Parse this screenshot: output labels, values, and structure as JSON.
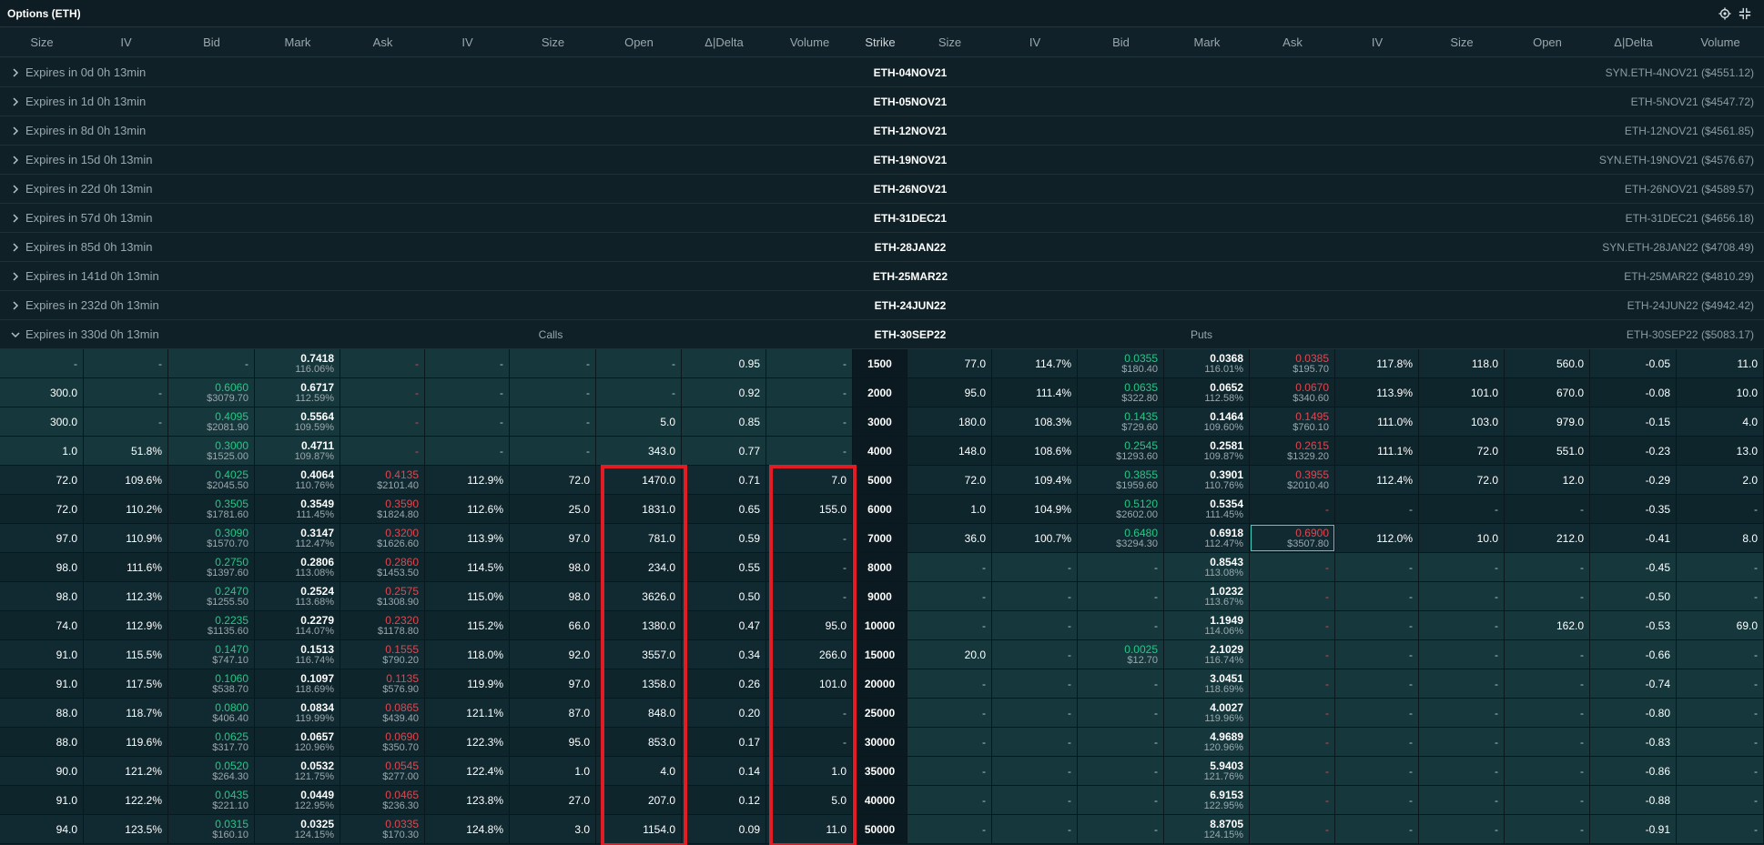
{
  "window": {
    "title": "Options (ETH)"
  },
  "header": {
    "call_cols": [
      "Size",
      "IV",
      "Bid",
      "Mark",
      "Ask",
      "IV",
      "Size",
      "Open",
      "Δ|Delta",
      "Volume"
    ],
    "strike": "Strike",
    "put_cols": [
      "Size",
      "IV",
      "Bid",
      "Mark",
      "Ask",
      "IV",
      "Size",
      "Open",
      "Δ|Delta",
      "Volume"
    ]
  },
  "expiries": [
    {
      "label": "Expires in 0d 0h 13min",
      "instrument": "ETH-04NOV21",
      "index": "SYN.ETH-4NOV21 ($4551.12)"
    },
    {
      "label": "Expires in 1d 0h 13min",
      "instrument": "ETH-05NOV21",
      "index": "ETH-5NOV21 ($4547.72)"
    },
    {
      "label": "Expires in 8d 0h 13min",
      "instrument": "ETH-12NOV21",
      "index": "ETH-12NOV21 ($4561.85)"
    },
    {
      "label": "Expires in 15d 0h 13min",
      "instrument": "ETH-19NOV21",
      "index": "SYN.ETH-19NOV21 ($4576.67)"
    },
    {
      "label": "Expires in 22d 0h 13min",
      "instrument": "ETH-26NOV21",
      "index": "ETH-26NOV21 ($4589.57)"
    },
    {
      "label": "Expires in 57d 0h 13min",
      "instrument": "ETH-31DEC21",
      "index": "ETH-31DEC21 ($4656.18)"
    },
    {
      "label": "Expires in 85d 0h 13min",
      "instrument": "ETH-28JAN22",
      "index": "SYN.ETH-28JAN22 ($4708.49)"
    },
    {
      "label": "Expires in 141d 0h 13min",
      "instrument": "ETH-25MAR22",
      "index": "ETH-25MAR22 ($4810.29)"
    },
    {
      "label": "Expires in 232d 0h 13min",
      "instrument": "ETH-24JUN22",
      "index": "ETH-24JUN22 ($4942.42)"
    }
  ],
  "expanded": {
    "label": "Expires in 330d 0h 13min",
    "calls_label": "Calls",
    "instrument": "ETH-30SEP22",
    "puts_label": "Puts",
    "index": "ETH-30SEP22 ($5083.17)"
  },
  "rows": [
    {
      "strike": "1500",
      "call": {
        "bid_size": "-",
        "bid_iv": "-",
        "bid": "-",
        "bid_usd": "",
        "mark": "0.7418",
        "mark_iv": "116.06%",
        "ask": "-",
        "ask_usd": "",
        "ask_iv": "-",
        "ask_size": "-",
        "open": "-",
        "delta": "0.95",
        "volume": "-"
      },
      "put": {
        "bid_size": "77.0",
        "bid_iv": "114.7%",
        "bid": "0.0355",
        "bid_usd": "$180.40",
        "mark": "0.0368",
        "mark_iv": "116.01%",
        "ask": "0.0385",
        "ask_usd": "$195.70",
        "ask_iv": "117.8%",
        "ask_size": "118.0",
        "open": "560.0",
        "delta": "-0.05",
        "volume": "11.0"
      }
    },
    {
      "strike": "2000",
      "call": {
        "bid_size": "300.0",
        "bid_iv": "-",
        "bid": "0.6060",
        "bid_usd": "$3079.70",
        "mark": "0.6717",
        "mark_iv": "112.59%",
        "ask": "-",
        "ask_usd": "",
        "ask_iv": "-",
        "ask_size": "-",
        "open": "-",
        "delta": "0.92",
        "volume": "-"
      },
      "put": {
        "bid_size": "95.0",
        "bid_iv": "111.4%",
        "bid": "0.0635",
        "bid_usd": "$322.80",
        "mark": "0.0652",
        "mark_iv": "112.58%",
        "ask": "0.0670",
        "ask_usd": "$340.60",
        "ask_iv": "113.9%",
        "ask_size": "101.0",
        "open": "670.0",
        "delta": "-0.08",
        "volume": "10.0"
      }
    },
    {
      "strike": "3000",
      "call": {
        "bid_size": "300.0",
        "bid_iv": "-",
        "bid": "0.4095",
        "bid_usd": "$2081.90",
        "mark": "0.5564",
        "mark_iv": "109.59%",
        "ask": "-",
        "ask_usd": "",
        "ask_iv": "-",
        "ask_size": "-",
        "open": "5.0",
        "delta": "0.85",
        "volume": "-"
      },
      "put": {
        "bid_size": "180.0",
        "bid_iv": "108.3%",
        "bid": "0.1435",
        "bid_usd": "$729.60",
        "mark": "0.1464",
        "mark_iv": "109.60%",
        "ask": "0.1495",
        "ask_usd": "$760.10",
        "ask_iv": "111.0%",
        "ask_size": "103.0",
        "open": "979.0",
        "delta": "-0.15",
        "volume": "4.0"
      }
    },
    {
      "strike": "4000",
      "call": {
        "bid_size": "1.0",
        "bid_iv": "51.8%",
        "bid": "0.3000",
        "bid_usd": "$1525.00",
        "mark": "0.4711",
        "mark_iv": "109.87%",
        "ask": "-",
        "ask_usd": "",
        "ask_iv": "-",
        "ask_size": "-",
        "open": "343.0",
        "delta": "0.77",
        "volume": "-"
      },
      "put": {
        "bid_size": "148.0",
        "bid_iv": "108.6%",
        "bid": "0.2545",
        "bid_usd": "$1293.60",
        "mark": "0.2581",
        "mark_iv": "109.87%",
        "ask": "0.2615",
        "ask_usd": "$1329.20",
        "ask_iv": "111.1%",
        "ask_size": "72.0",
        "open": "551.0",
        "delta": "-0.23",
        "volume": "13.0"
      }
    },
    {
      "strike": "5000",
      "call": {
        "bid_size": "72.0",
        "bid_iv": "109.6%",
        "bid": "0.4025",
        "bid_usd": "$2045.50",
        "mark": "0.4064",
        "mark_iv": "110.76%",
        "ask": "0.4135",
        "ask_usd": "$2101.40",
        "ask_iv": "112.9%",
        "ask_size": "72.0",
        "open": "1470.0",
        "delta": "0.71",
        "volume": "7.0"
      },
      "put": {
        "bid_size": "72.0",
        "bid_iv": "109.4%",
        "bid": "0.3855",
        "bid_usd": "$1959.60",
        "mark": "0.3901",
        "mark_iv": "110.76%",
        "ask": "0.3955",
        "ask_usd": "$2010.40",
        "ask_iv": "112.4%",
        "ask_size": "72.0",
        "open": "12.0",
        "delta": "-0.29",
        "volume": "2.0"
      }
    },
    {
      "strike": "6000",
      "call": {
        "bid_size": "72.0",
        "bid_iv": "110.2%",
        "bid": "0.3505",
        "bid_usd": "$1781.60",
        "mark": "0.3549",
        "mark_iv": "111.45%",
        "ask": "0.3590",
        "ask_usd": "$1824.80",
        "ask_iv": "112.6%",
        "ask_size": "25.0",
        "open": "1831.0",
        "delta": "0.65",
        "volume": "155.0"
      },
      "put": {
        "bid_size": "1.0",
        "bid_iv": "104.9%",
        "bid": "0.5120",
        "bid_usd": "$2602.00",
        "mark": "0.5354",
        "mark_iv": "111.45%",
        "ask": "-",
        "ask_usd": "",
        "ask_iv": "-",
        "ask_size": "-",
        "open": "-",
        "delta": "-0.35",
        "volume": "-"
      }
    },
    {
      "strike": "7000",
      "call": {
        "bid_size": "97.0",
        "bid_iv": "110.9%",
        "bid": "0.3090",
        "bid_usd": "$1570.70",
        "mark": "0.3147",
        "mark_iv": "112.47%",
        "ask": "0.3200",
        "ask_usd": "$1626.60",
        "ask_iv": "113.9%",
        "ask_size": "97.0",
        "open": "781.0",
        "delta": "0.59",
        "volume": "-"
      },
      "put": {
        "bid_size": "36.0",
        "bid_iv": "100.7%",
        "bid": "0.6480",
        "bid_usd": "$3294.30",
        "mark": "0.6918",
        "mark_iv": "112.47%",
        "ask": "0.6900",
        "ask_usd": "$3507.80",
        "ask_iv": "112.0%",
        "ask_size": "10.0",
        "open": "212.0",
        "delta": "-0.41",
        "volume": "8.0"
      }
    },
    {
      "strike": "8000",
      "call": {
        "bid_size": "98.0",
        "bid_iv": "111.6%",
        "bid": "0.2750",
        "bid_usd": "$1397.60",
        "mark": "0.2806",
        "mark_iv": "113.08%",
        "ask": "0.2860",
        "ask_usd": "$1453.50",
        "ask_iv": "114.5%",
        "ask_size": "98.0",
        "open": "234.0",
        "delta": "0.55",
        "volume": "-"
      },
      "put": {
        "bid_size": "-",
        "bid_iv": "-",
        "bid": "-",
        "bid_usd": "",
        "mark": "0.8543",
        "mark_iv": "113.08%",
        "ask": "-",
        "ask_usd": "",
        "ask_iv": "-",
        "ask_size": "-",
        "open": "-",
        "delta": "-0.45",
        "volume": "-"
      }
    },
    {
      "strike": "9000",
      "call": {
        "bid_size": "98.0",
        "bid_iv": "112.3%",
        "bid": "0.2470",
        "bid_usd": "$1255.50",
        "mark": "0.2524",
        "mark_iv": "113.68%",
        "ask": "0.2575",
        "ask_usd": "$1308.90",
        "ask_iv": "115.0%",
        "ask_size": "98.0",
        "open": "3626.0",
        "delta": "0.50",
        "volume": "-"
      },
      "put": {
        "bid_size": "-",
        "bid_iv": "-",
        "bid": "-",
        "bid_usd": "",
        "mark": "1.0232",
        "mark_iv": "113.67%",
        "ask": "-",
        "ask_usd": "",
        "ask_iv": "-",
        "ask_size": "-",
        "open": "-",
        "delta": "-0.50",
        "volume": "-"
      }
    },
    {
      "strike": "10000",
      "call": {
        "bid_size": "74.0",
        "bid_iv": "112.9%",
        "bid": "0.2235",
        "bid_usd": "$1135.60",
        "mark": "0.2279",
        "mark_iv": "114.07%",
        "ask": "0.2320",
        "ask_usd": "$1178.80",
        "ask_iv": "115.2%",
        "ask_size": "66.0",
        "open": "1380.0",
        "delta": "0.47",
        "volume": "95.0"
      },
      "put": {
        "bid_size": "-",
        "bid_iv": "-",
        "bid": "-",
        "bid_usd": "",
        "mark": "1.1949",
        "mark_iv": "114.06%",
        "ask": "-",
        "ask_usd": "",
        "ask_iv": "-",
        "ask_size": "-",
        "open": "162.0",
        "delta": "-0.53",
        "volume": "69.0"
      }
    },
    {
      "strike": "15000",
      "call": {
        "bid_size": "91.0",
        "bid_iv": "115.5%",
        "bid": "0.1470",
        "bid_usd": "$747.10",
        "mark": "0.1513",
        "mark_iv": "116.74%",
        "ask": "0.1555",
        "ask_usd": "$790.20",
        "ask_iv": "118.0%",
        "ask_size": "92.0",
        "open": "3557.0",
        "delta": "0.34",
        "volume": "266.0"
      },
      "put": {
        "bid_size": "20.0",
        "bid_iv": "-",
        "bid": "0.0025",
        "bid_usd": "$12.70",
        "mark": "2.1029",
        "mark_iv": "116.74%",
        "ask": "-",
        "ask_usd": "",
        "ask_iv": "-",
        "ask_size": "-",
        "open": "-",
        "delta": "-0.66",
        "volume": "-"
      }
    },
    {
      "strike": "20000",
      "call": {
        "bid_size": "91.0",
        "bid_iv": "117.5%",
        "bid": "0.1060",
        "bid_usd": "$538.70",
        "mark": "0.1097",
        "mark_iv": "118.69%",
        "ask": "0.1135",
        "ask_usd": "$576.90",
        "ask_iv": "119.9%",
        "ask_size": "97.0",
        "open": "1358.0",
        "delta": "0.26",
        "volume": "101.0"
      },
      "put": {
        "bid_size": "-",
        "bid_iv": "-",
        "bid": "-",
        "bid_usd": "",
        "mark": "3.0451",
        "mark_iv": "118.69%",
        "ask": "-",
        "ask_usd": "",
        "ask_iv": "-",
        "ask_size": "-",
        "open": "-",
        "delta": "-0.74",
        "volume": "-"
      }
    },
    {
      "strike": "25000",
      "call": {
        "bid_size": "88.0",
        "bid_iv": "118.7%",
        "bid": "0.0800",
        "bid_usd": "$406.40",
        "mark": "0.0834",
        "mark_iv": "119.99%",
        "ask": "0.0865",
        "ask_usd": "$439.40",
        "ask_iv": "121.1%",
        "ask_size": "87.0",
        "open": "848.0",
        "delta": "0.20",
        "volume": "-"
      },
      "put": {
        "bid_size": "-",
        "bid_iv": "-",
        "bid": "-",
        "bid_usd": "",
        "mark": "4.0027",
        "mark_iv": "119.96%",
        "ask": "-",
        "ask_usd": "",
        "ask_iv": "-",
        "ask_size": "-",
        "open": "-",
        "delta": "-0.80",
        "volume": "-"
      }
    },
    {
      "strike": "30000",
      "call": {
        "bid_size": "88.0",
        "bid_iv": "119.6%",
        "bid": "0.0625",
        "bid_usd": "$317.70",
        "mark": "0.0657",
        "mark_iv": "120.96%",
        "ask": "0.0690",
        "ask_usd": "$350.70",
        "ask_iv": "122.3%",
        "ask_size": "95.0",
        "open": "853.0",
        "delta": "0.17",
        "volume": "-"
      },
      "put": {
        "bid_size": "-",
        "bid_iv": "-",
        "bid": "-",
        "bid_usd": "",
        "mark": "4.9689",
        "mark_iv": "120.96%",
        "ask": "-",
        "ask_usd": "",
        "ask_iv": "-",
        "ask_size": "-",
        "open": "-",
        "delta": "-0.83",
        "volume": "-"
      }
    },
    {
      "strike": "35000",
      "call": {
        "bid_size": "90.0",
        "bid_iv": "121.2%",
        "bid": "0.0520",
        "bid_usd": "$264.30",
        "mark": "0.0532",
        "mark_iv": "121.75%",
        "ask": "0.0545",
        "ask_usd": "$277.00",
        "ask_iv": "122.4%",
        "ask_size": "1.0",
        "open": "4.0",
        "delta": "0.14",
        "volume": "1.0"
      },
      "put": {
        "bid_size": "-",
        "bid_iv": "-",
        "bid": "-",
        "bid_usd": "",
        "mark": "5.9403",
        "mark_iv": "121.76%",
        "ask": "-",
        "ask_usd": "",
        "ask_iv": "-",
        "ask_size": "-",
        "open": "-",
        "delta": "-0.86",
        "volume": "-"
      }
    },
    {
      "strike": "40000",
      "call": {
        "bid_size": "91.0",
        "bid_iv": "122.2%",
        "bid": "0.0435",
        "bid_usd": "$221.10",
        "mark": "0.0449",
        "mark_iv": "122.95%",
        "ask": "0.0465",
        "ask_usd": "$236.30",
        "ask_iv": "123.8%",
        "ask_size": "27.0",
        "open": "207.0",
        "delta": "0.12",
        "volume": "5.0"
      },
      "put": {
        "bid_size": "-",
        "bid_iv": "-",
        "bid": "-",
        "bid_usd": "",
        "mark": "6.9153",
        "mark_iv": "122.95%",
        "ask": "-",
        "ask_usd": "",
        "ask_iv": "-",
        "ask_size": "-",
        "open": "-",
        "delta": "-0.88",
        "volume": "-"
      }
    },
    {
      "strike": "50000",
      "call": {
        "bid_size": "94.0",
        "bid_iv": "123.5%",
        "bid": "0.0315",
        "bid_usd": "$160.10",
        "mark": "0.0325",
        "mark_iv": "124.15%",
        "ask": "0.0335",
        "ask_usd": "$170.30",
        "ask_iv": "124.8%",
        "ask_size": "3.0",
        "open": "1154.0",
        "delta": "0.09",
        "volume": "11.0"
      },
      "put": {
        "bid_size": "-",
        "bid_iv": "-",
        "bid": "-",
        "bid_usd": "",
        "mark": "8.8705",
        "mark_iv": "124.15%",
        "ask": "-",
        "ask_usd": "",
        "ask_iv": "-",
        "ask_size": "-",
        "open": "-",
        "delta": "-0.91",
        "volume": "-"
      }
    }
  ],
  "icons": {
    "settings": "gear-icon",
    "collapse": "collapse-icon",
    "expand": "chevron-right-icon",
    "expanded": "chevron-down-icon"
  },
  "colors": {
    "bid_green": "#22c985",
    "ask_red": "#e4454f",
    "highlight": "#e21b24"
  }
}
